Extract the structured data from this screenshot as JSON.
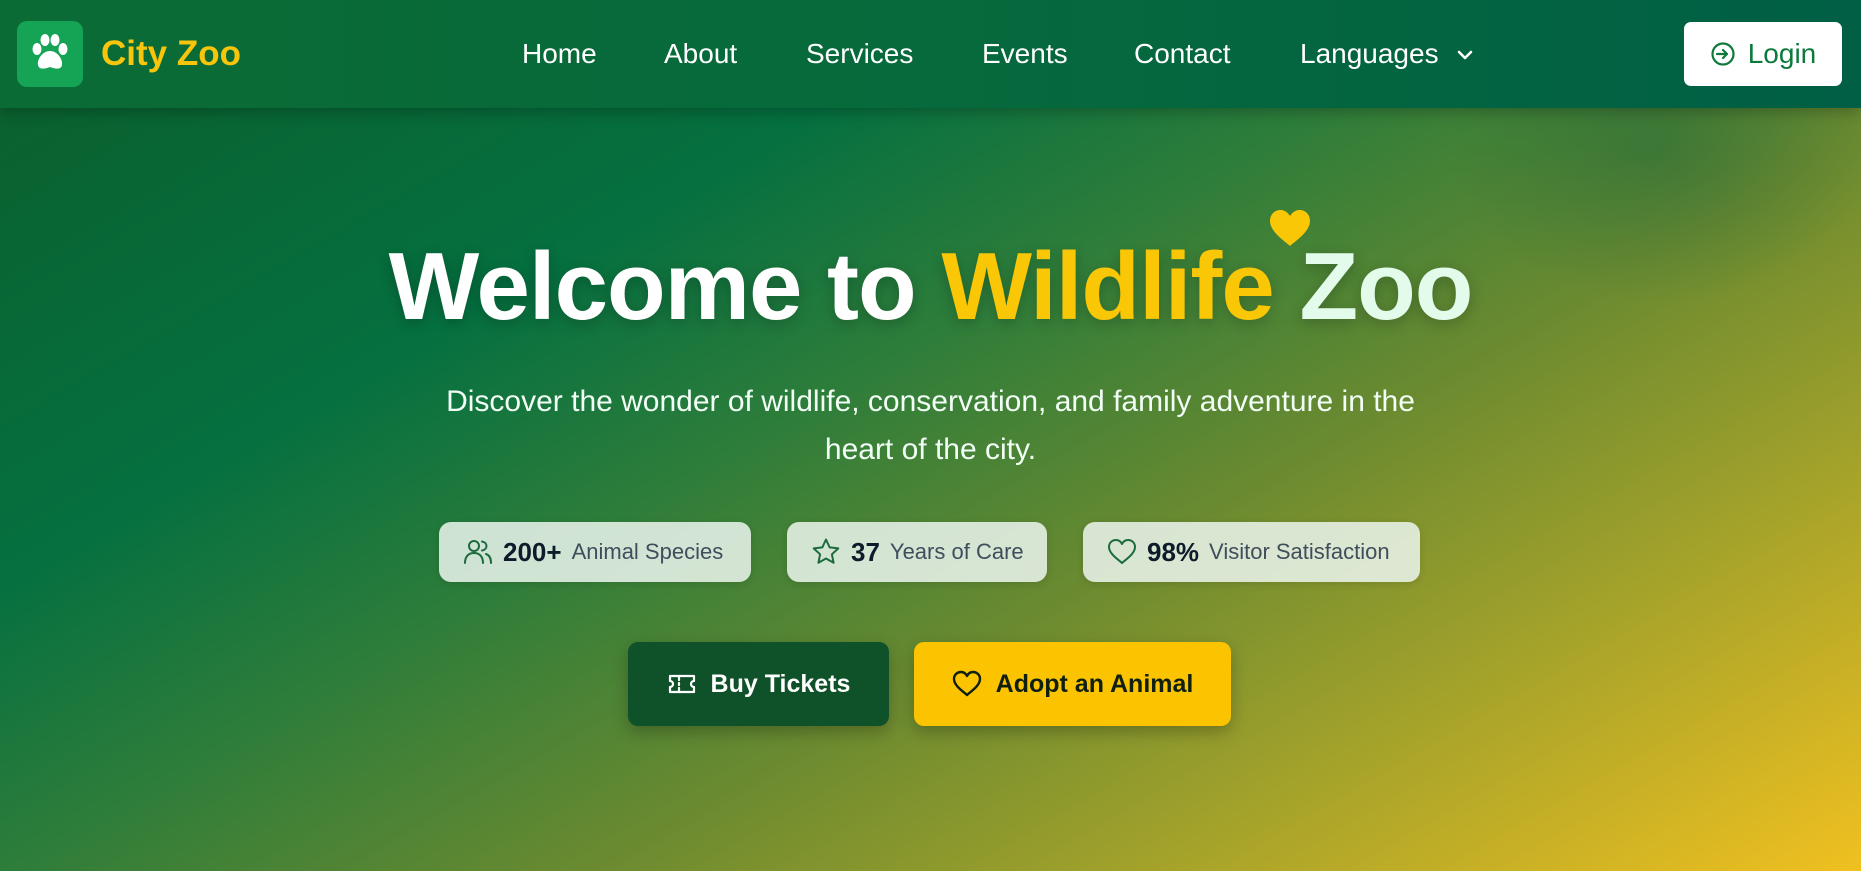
{
  "navbar": {
    "logo_icon": "paw-icon",
    "brand": "City Zoo",
    "links": [
      "Home",
      "About",
      "Services",
      "Events",
      "Contact",
      "Languages"
    ],
    "login_label": "Login",
    "login_icon": "sign-in-icon"
  },
  "hero": {
    "title_part1": "Welcome to ",
    "title_part2": "Wildlife",
    "title_part3": " Zoo",
    "subtitle": "Discover the wonder of wildlife, conservation, and family adventure in the heart of the city.",
    "stats": [
      {
        "icon": "users-icon",
        "value": "200+",
        "label": "Animal Species"
      },
      {
        "icon": "star-icon",
        "value": "37",
        "label": "Years of Care"
      },
      {
        "icon": "heart-icon",
        "value": "98%",
        "label": "Visitor Satisfaction"
      }
    ],
    "buttons": {
      "buy_tickets": "Buy Tickets",
      "adopt": "Adopt an Animal"
    }
  },
  "colors": {
    "nav": "#066a3c",
    "brand_yellow": "#f7c50b",
    "accent_yellow": "#fcc400",
    "dark_green": "#0f5128"
  }
}
